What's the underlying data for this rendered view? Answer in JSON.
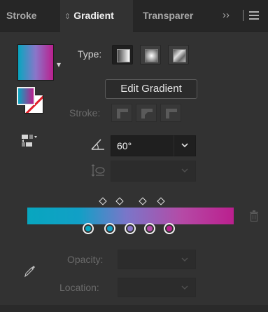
{
  "tabs": [
    {
      "label": "Stroke",
      "active": false
    },
    {
      "label": "Gradient",
      "active": true
    },
    {
      "label": "Transparer",
      "active": false
    }
  ],
  "overflow_symbol": "››",
  "gradient": {
    "type_label": "Type:",
    "type_options": [
      "linear-gradient-icon",
      "radial-gradient-icon",
      "freeform-gradient-icon"
    ],
    "selected_type": "linear",
    "edit_button": "Edit Gradient",
    "stroke_label": "Stroke:",
    "angle": "60°",
    "aspect_ratio": "",
    "stops": [
      "#08a6bf",
      "#11a0c6",
      "#8a76c9",
      "#b54aa6",
      "#bb1f8e"
    ],
    "opacity_label": "Opacity:",
    "location_label": "Location:",
    "opacity": "",
    "location": ""
  },
  "colors": {
    "panel_bg": "#323232",
    "tabbar_bg": "#262626",
    "accent_start": "#08a6bf",
    "accent_end": "#bb1f8e"
  }
}
